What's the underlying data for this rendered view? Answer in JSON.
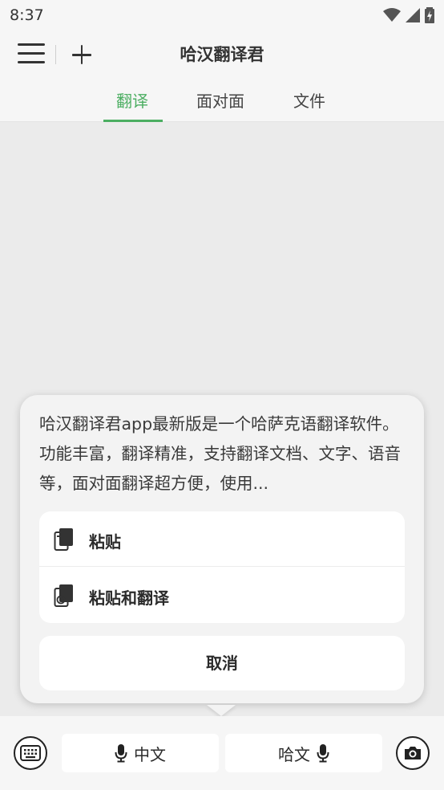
{
  "status_bar": {
    "time": "8:37",
    "icons": [
      "wifi-icon",
      "signal-icon",
      "battery-charging-icon"
    ]
  },
  "app_bar": {
    "title": "哈汉翻译君",
    "menu_icon": "menu-icon",
    "add_icon": "add-icon"
  },
  "tabs": [
    {
      "label": "翻译",
      "active": true
    },
    {
      "label": "面对面",
      "active": false
    },
    {
      "label": "文件",
      "active": false
    }
  ],
  "popup": {
    "clipboard_text": "哈汉翻译君app最新版是一个哈萨克语翻译软件。功能丰富，翻译精准，支持翻译文档、文字、语音等，面对面翻译超方便，使用...",
    "actions": [
      {
        "label": "粘贴",
        "icon": "paste-icon"
      },
      {
        "label": "粘贴和翻译",
        "icon": "paste-translate-icon"
      }
    ],
    "cancel_label": "取消"
  },
  "bottom_bar": {
    "keyboard_icon": "keyboard-icon",
    "source_lang": "中文",
    "target_lang": "哈文",
    "mic_icon": "mic-icon",
    "camera_icon": "camera-icon"
  },
  "colors": {
    "accent": "#4cae62",
    "background": "#ebebeb",
    "bar": "#f6f6f6"
  }
}
